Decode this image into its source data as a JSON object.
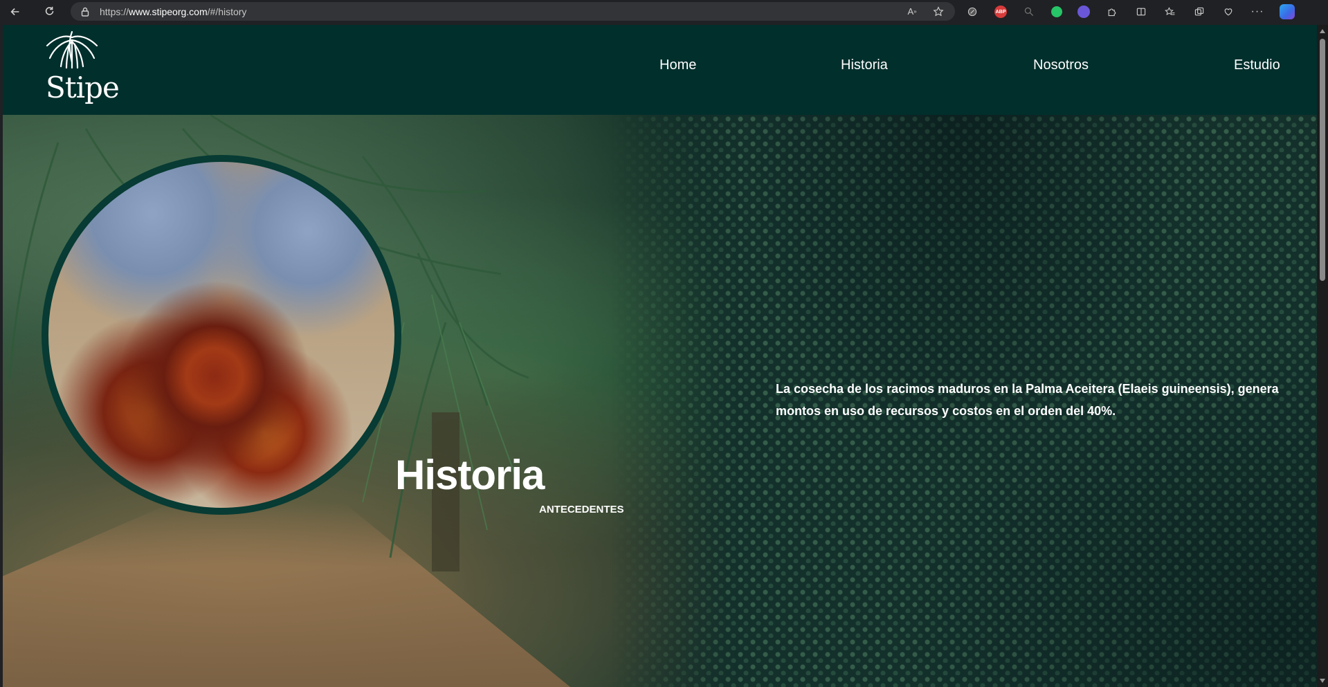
{
  "browser": {
    "url_prefix": "https://",
    "url_host": "www.stipeorg.com",
    "url_path": "/#/history"
  },
  "site": {
    "logo_text": "Stipe",
    "nav": {
      "home": "Home",
      "historia": "Historia",
      "nosotros": "Nosotros",
      "estudio": "Estudio"
    }
  },
  "hero": {
    "title": "Historia",
    "subtitle": "ANTECEDENTES",
    "description": "La cosecha de los racimos maduros en la Palma Aceitera (Elaeis guineensis), genera montos en uso de recursos y costos en el orden del 40%."
  },
  "colors": {
    "header_bg": "#012f2c",
    "circle_border": "#073b33",
    "text": "#ffffff"
  },
  "icons": [
    "back-icon",
    "refresh-icon",
    "lock-icon",
    "read-aloud-icon",
    "favorite-star-icon",
    "extension-icon",
    "adblock-icon",
    "zoom-icon",
    "green-status-icon",
    "profile-extension-icon",
    "puzzle-icon",
    "split-screen-icon",
    "favorites-icon",
    "collections-icon",
    "health-icon",
    "more-icon",
    "copilot-icon",
    "palm-logo-icon"
  ]
}
